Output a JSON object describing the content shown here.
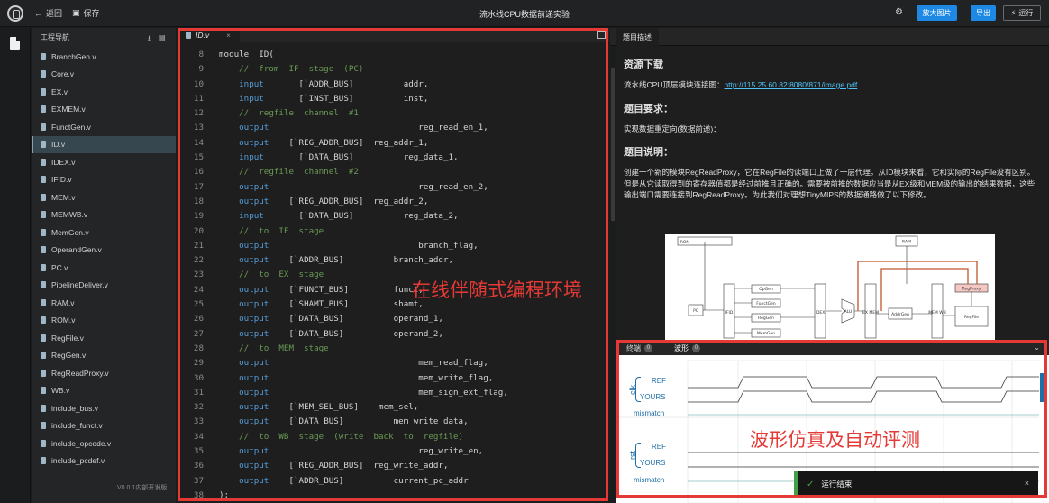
{
  "topbar": {
    "back_label": "返回",
    "save_label": "保存",
    "title": "流水线CPU数据前递实验",
    "enlarge_label": "放大图片",
    "export_label": "导出",
    "run_label": "运行"
  },
  "sidebar": {
    "title": "工程导航",
    "items": [
      "BranchGen.v",
      "Core.v",
      "EX.v",
      "EXMEM.v",
      "FunctGen.v",
      "ID.v",
      "IDEX.v",
      "IFID.v",
      "MEM.v",
      "MEMWB.v",
      "MemGen.v",
      "OperandGen.v",
      "PC.v",
      "PipelineDeliver.v",
      "RAM.v",
      "ROM.v",
      "RegFile.v",
      "RegGen.v",
      "RegReadProxy.v",
      "WB.v",
      "include_bus.v",
      "include_funct.v",
      "include_opcode.v",
      "include_pcdef.v"
    ],
    "active_index": 5,
    "version": "V0.0.1内部开发版"
  },
  "editor": {
    "tab": "ID.v",
    "overlay_label": "在线伴随式编程环境",
    "lines": [
      {
        "n": "8",
        "segs": [
          [
            "module  ID(",
            ""
          ]
        ]
      },
      {
        "n": "9",
        "segs": [
          [
            "    ",
            ""
          ],
          [
            "//  from  IF  stage  (PC)",
            "cm"
          ]
        ]
      },
      {
        "n": "10",
        "segs": [
          [
            "    ",
            ""
          ],
          [
            "input",
            "kw"
          ],
          [
            "       [`ADDR_BUS]          addr,",
            ""
          ]
        ]
      },
      {
        "n": "11",
        "segs": [
          [
            "    ",
            ""
          ],
          [
            "input",
            "kw"
          ],
          [
            "       [`INST_BUS]          inst,",
            ""
          ]
        ]
      },
      {
        "n": "12",
        "segs": [
          [
            "    ",
            ""
          ],
          [
            "//  regfile  channel  #1",
            "cm"
          ]
        ]
      },
      {
        "n": "13",
        "segs": [
          [
            "    ",
            ""
          ],
          [
            "output",
            "kw"
          ],
          [
            "                              reg_read_en_1,",
            ""
          ]
        ]
      },
      {
        "n": "14",
        "segs": [
          [
            "    ",
            ""
          ],
          [
            "output",
            "kw"
          ],
          [
            "    [`REG_ADDR_BUS]  reg_addr_1,",
            ""
          ]
        ]
      },
      {
        "n": "15",
        "segs": [
          [
            "    ",
            ""
          ],
          [
            "input",
            "kw"
          ],
          [
            "       [`DATA_BUS]          reg_data_1,",
            ""
          ]
        ]
      },
      {
        "n": "16",
        "segs": [
          [
            "    ",
            ""
          ],
          [
            "//  regfile  channel  #2",
            "cm"
          ]
        ]
      },
      {
        "n": "17",
        "segs": [
          [
            "    ",
            ""
          ],
          [
            "output",
            "kw"
          ],
          [
            "                              reg_read_en_2,",
            ""
          ]
        ]
      },
      {
        "n": "18",
        "segs": [
          [
            "    ",
            ""
          ],
          [
            "output",
            "kw"
          ],
          [
            "    [`REG_ADDR_BUS]  reg_addr_2,",
            ""
          ]
        ]
      },
      {
        "n": "19",
        "segs": [
          [
            "    ",
            ""
          ],
          [
            "input",
            "kw"
          ],
          [
            "       [`DATA_BUS]          reg_data_2,",
            ""
          ]
        ]
      },
      {
        "n": "20",
        "segs": [
          [
            "    ",
            ""
          ],
          [
            "//  to  IF  stage",
            "cm"
          ]
        ]
      },
      {
        "n": "21",
        "segs": [
          [
            "    ",
            ""
          ],
          [
            "output",
            "kw"
          ],
          [
            "                              branch_flag,",
            ""
          ]
        ]
      },
      {
        "n": "22",
        "segs": [
          [
            "    ",
            ""
          ],
          [
            "output",
            "kw"
          ],
          [
            "    [`ADDR_BUS]          branch_addr,",
            ""
          ]
        ]
      },
      {
        "n": "23",
        "segs": [
          [
            "    ",
            ""
          ],
          [
            "//  to  EX  stage",
            "cm"
          ]
        ]
      },
      {
        "n": "24",
        "segs": [
          [
            "    ",
            ""
          ],
          [
            "output",
            "kw"
          ],
          [
            "    [`FUNCT_BUS]         funct,",
            ""
          ]
        ]
      },
      {
        "n": "25",
        "segs": [
          [
            "    ",
            ""
          ],
          [
            "output",
            "kw"
          ],
          [
            "    [`SHAMT_BUS]         shamt,",
            ""
          ]
        ]
      },
      {
        "n": "26",
        "segs": [
          [
            "    ",
            ""
          ],
          [
            "output",
            "kw"
          ],
          [
            "    [`DATA_BUS]          operand_1,",
            ""
          ]
        ]
      },
      {
        "n": "27",
        "segs": [
          [
            "    ",
            ""
          ],
          [
            "output",
            "kw"
          ],
          [
            "    [`DATA_BUS]          operand_2,",
            ""
          ]
        ]
      },
      {
        "n": "28",
        "segs": [
          [
            "    ",
            ""
          ],
          [
            "//  to  MEM  stage",
            "cm"
          ]
        ]
      },
      {
        "n": "29",
        "segs": [
          [
            "    ",
            ""
          ],
          [
            "output",
            "kw"
          ],
          [
            "                              mem_read_flag,",
            ""
          ]
        ]
      },
      {
        "n": "30",
        "segs": [
          [
            "    ",
            ""
          ],
          [
            "output",
            "kw"
          ],
          [
            "                              mem_write_flag,",
            ""
          ]
        ]
      },
      {
        "n": "31",
        "segs": [
          [
            "    ",
            ""
          ],
          [
            "output",
            "kw"
          ],
          [
            "                              mem_sign_ext_flag,",
            ""
          ]
        ]
      },
      {
        "n": "32",
        "segs": [
          [
            "    ",
            ""
          ],
          [
            "output",
            "kw"
          ],
          [
            "    [`MEM_SEL_BUS]    mem_sel,",
            ""
          ]
        ]
      },
      {
        "n": "33",
        "segs": [
          [
            "    ",
            ""
          ],
          [
            "output",
            "kw"
          ],
          [
            "    [`DATA_BUS]          mem_write_data,",
            ""
          ]
        ]
      },
      {
        "n": "34",
        "segs": [
          [
            "    ",
            ""
          ],
          [
            "//  to  WB  stage  (write  back  to  regfile)",
            "cm"
          ]
        ]
      },
      {
        "n": "35",
        "segs": [
          [
            "    ",
            ""
          ],
          [
            "output",
            "kw"
          ],
          [
            "                              reg_write_en,",
            ""
          ]
        ]
      },
      {
        "n": "36",
        "segs": [
          [
            "    ",
            ""
          ],
          [
            "output",
            "kw"
          ],
          [
            "    [`REG_ADDR_BUS]  reg_write_addr,",
            ""
          ]
        ]
      },
      {
        "n": "37",
        "segs": [
          [
            "    ",
            ""
          ],
          [
            "output",
            "kw"
          ],
          [
            "    [`ADDR_BUS]          current_pc_addr",
            ""
          ]
        ]
      },
      {
        "n": "38",
        "segs": [
          [
            ");",
            ""
          ]
        ]
      }
    ]
  },
  "description": {
    "tab": "题目描述",
    "h_resources": "资源下载",
    "resource_text": "流水线CPU顶层模块连接图：",
    "resource_link": "http://115.25.60.82:8080/871/image.pdf",
    "h_requirement": "题目要求：",
    "requirement_text": "实现数据重定向(数据前递)：",
    "h_explain": "题目说明：",
    "explain_text": "创建一个新的模块RegReadProxy，它在RegFile的读端口上做了一层代理。从ID模块来看，它和实际的RegFile没有区别。但是从它读取得到的寄存器值都是经过前推且正确的。需要被前推的数据应当是从EX级和MEM级的输出的结果数据，这些输出端口需要连接到RegReadProxy。为此我们对理想TinyMIPS的数据通路做了以下修改。",
    "diagram": {
      "rom": "ROM",
      "ram": "RAM",
      "pc": "PC",
      "ifid": "IFID",
      "opgen": "OpGen",
      "functgen": "FunctGen",
      "reggen": "RegGen",
      "memgen": "MemGen",
      "idex": "IDEX",
      "alu": "ALU",
      "exmem": "EX\nMEM",
      "addrgen": "AddrGen",
      "memwb": "MEM\nWB",
      "regfile": "RegFile",
      "proxy": "RegProxy"
    }
  },
  "waveform": {
    "tab_terminal": "终端",
    "tab_wave": "波形",
    "terminal_badge": "0",
    "wave_badge": "0",
    "overlay_label": "波形仿真及自动评测",
    "signals": [
      {
        "name": "clk",
        "ref": "REF",
        "yours": "YOURS",
        "mismatch": "mismatch"
      },
      {
        "name": "rst",
        "ref": "REF",
        "yours": "YOURS",
        "mismatch": "mismatch"
      }
    ],
    "toast": "运行结束!"
  },
  "colors": {
    "accent": "#1e88e5",
    "highlight_frame": "#e53935",
    "success": "#43a047"
  }
}
